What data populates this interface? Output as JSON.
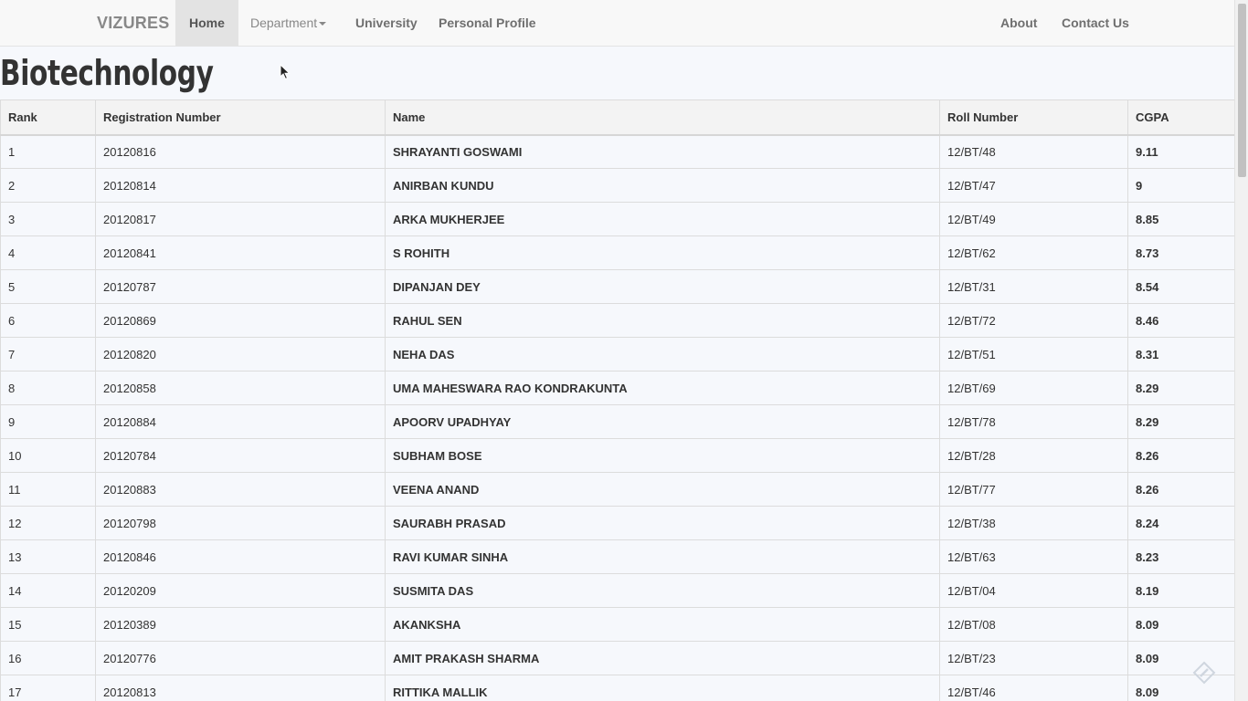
{
  "navbar": {
    "brand": "VIZURES",
    "items": [
      {
        "label": "Home"
      },
      {
        "label": "Department"
      },
      {
        "label": "University"
      },
      {
        "label": "Personal Profile"
      }
    ],
    "right_items": [
      {
        "label": "About"
      },
      {
        "label": "Contact Us"
      }
    ]
  },
  "page": {
    "title": "Biotechnology"
  },
  "table": {
    "headers": [
      "Rank",
      "Registration Number",
      "Name",
      "Roll Number",
      "CGPA"
    ],
    "rows": [
      {
        "rank": "1",
        "reg": "20120816",
        "name": "SHRAYANTI GOSWAMI",
        "roll": "12/BT/48",
        "cgpa": "9.11"
      },
      {
        "rank": "2",
        "reg": "20120814",
        "name": "ANIRBAN KUNDU",
        "roll": "12/BT/47",
        "cgpa": "9"
      },
      {
        "rank": "3",
        "reg": "20120817",
        "name": "ARKA MUKHERJEE",
        "roll": "12/BT/49",
        "cgpa": "8.85"
      },
      {
        "rank": "4",
        "reg": "20120841",
        "name": "S ROHITH",
        "roll": "12/BT/62",
        "cgpa": "8.73"
      },
      {
        "rank": "5",
        "reg": "20120787",
        "name": "DIPANJAN DEY",
        "roll": "12/BT/31",
        "cgpa": "8.54"
      },
      {
        "rank": "6",
        "reg": "20120869",
        "name": "RAHUL SEN",
        "roll": "12/BT/72",
        "cgpa": "8.46"
      },
      {
        "rank": "7",
        "reg": "20120820",
        "name": "NEHA DAS",
        "roll": "12/BT/51",
        "cgpa": "8.31"
      },
      {
        "rank": "8",
        "reg": "20120858",
        "name": "UMA MAHESWARA RAO KONDRAKUNTA",
        "roll": "12/BT/69",
        "cgpa": "8.29"
      },
      {
        "rank": "9",
        "reg": "20120884",
        "name": "APOORV UPADHYAY",
        "roll": "12/BT/78",
        "cgpa": "8.29"
      },
      {
        "rank": "10",
        "reg": "20120784",
        "name": "SUBHAM BOSE",
        "roll": "12/BT/28",
        "cgpa": "8.26"
      },
      {
        "rank": "11",
        "reg": "20120883",
        "name": "VEENA ANAND",
        "roll": "12/BT/77",
        "cgpa": "8.26"
      },
      {
        "rank": "12",
        "reg": "20120798",
        "name": "SAURABH PRASAD",
        "roll": "12/BT/38",
        "cgpa": "8.24"
      },
      {
        "rank": "13",
        "reg": "20120846",
        "name": "RAVI KUMAR SINHA",
        "roll": "12/BT/63",
        "cgpa": "8.23"
      },
      {
        "rank": "14",
        "reg": "20120209",
        "name": "SUSMITA DAS",
        "roll": "12/BT/04",
        "cgpa": "8.19"
      },
      {
        "rank": "15",
        "reg": "20120389",
        "name": "AKANKSHA",
        "roll": "12/BT/08",
        "cgpa": "8.09"
      },
      {
        "rank": "16",
        "reg": "20120776",
        "name": "AMIT PRAKASH SHARMA",
        "roll": "12/BT/23",
        "cgpa": "8.09"
      },
      {
        "rank": "17",
        "reg": "20120813",
        "name": "RITTIKA MALLIK",
        "roll": "12/BT/46",
        "cgpa": "8.09"
      }
    ]
  },
  "icons": {
    "cursor": "mouse-pointer-icon",
    "floating": "pencil-icon"
  }
}
